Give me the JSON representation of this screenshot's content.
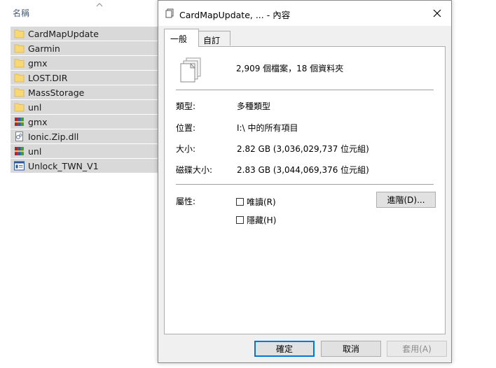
{
  "explorer": {
    "column_header": "名稱",
    "files": [
      {
        "name": "CardMapUpdate",
        "icon": "folder-icon"
      },
      {
        "name": "Garmin",
        "icon": "folder-icon"
      },
      {
        "name": "gmx",
        "icon": "folder-icon"
      },
      {
        "name": "LOST.DIR",
        "icon": "folder-icon"
      },
      {
        "name": "MassStorage",
        "icon": "folder-icon"
      },
      {
        "name": "unl",
        "icon": "folder-icon"
      },
      {
        "name": "gmx",
        "icon": "archive-icon"
      },
      {
        "name": "Ionic.Zip.dll",
        "icon": "dll-icon"
      },
      {
        "name": "unl",
        "icon": "archive-icon"
      },
      {
        "name": "Unlock_TWN_V1",
        "icon": "app-icon"
      }
    ]
  },
  "dialog": {
    "title": "CardMapUpdate, ... - 內容",
    "tabs": [
      {
        "label": "一般",
        "active": true
      },
      {
        "label": "自訂",
        "active": false
      }
    ],
    "summary": "2,909 個檔案，18 個資料夾",
    "rows": [
      {
        "label": "類型:",
        "value": "多種類型"
      },
      {
        "label": "位置:",
        "value": "I:\\ 中的所有項目"
      },
      {
        "label": "大小:",
        "value": "2.82 GB (3,036,029,737 位元組)"
      },
      {
        "label": "磁碟大小:",
        "value": "2.83 GB (3,044,069,376 位元組)"
      }
    ],
    "attributes_label": "屬性:",
    "readonly_label": "唯讀(R)",
    "hidden_label": "隱藏(H)",
    "advanced_button": "進階(D)...",
    "ok_button": "確定",
    "cancel_button": "取消",
    "apply_button": "套用(A)"
  },
  "colors": {
    "folder": "#f8d775",
    "selection": "#d9d9d9",
    "accent": "#0078d7"
  }
}
